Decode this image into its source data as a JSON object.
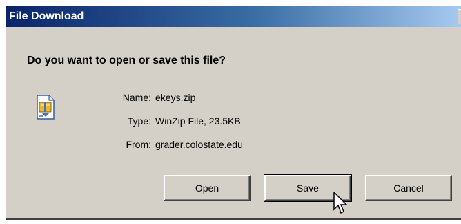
{
  "window": {
    "title": "File Download"
  },
  "prompt": {
    "question": "Do you want to open or save this file?"
  },
  "file": {
    "icon": "zip-file-icon",
    "name_label": "Name:",
    "name_value": "ekeys.zip",
    "type_label": "Type:",
    "type_value": "WinZip File, 23.5KB",
    "from_label": "From:",
    "from_value": "grader.colostate.edu"
  },
  "buttons": {
    "open_label": "Open",
    "save_label": "Save",
    "cancel_label": "Cancel"
  },
  "colors": {
    "titlebar_start": "#0a246a",
    "titlebar_end": "#a6caf0",
    "dialog_bg": "#d4d0c8"
  }
}
